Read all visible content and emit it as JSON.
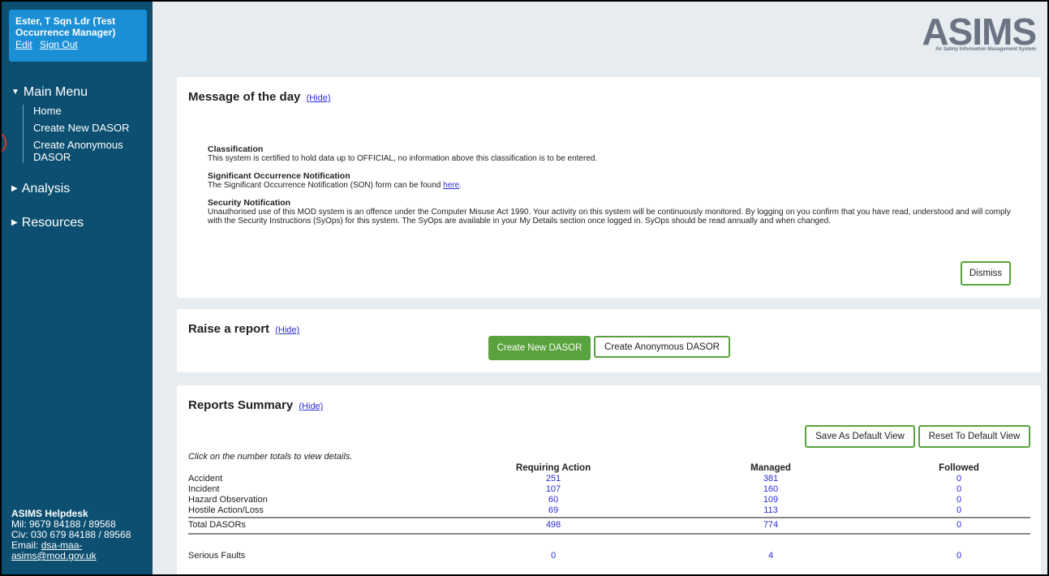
{
  "user": {
    "name_line1": "Ester, T Sqn Ldr (Test",
    "name_line2": "Occurrence Manager)",
    "edit_label": "Edit",
    "signout_label": "Sign Out"
  },
  "menu": {
    "main_label": "Main Menu",
    "items": [
      "Home",
      "Create New DASOR",
      "Create Anonymous DASOR"
    ],
    "analysis_label": "Analysis",
    "resources_label": "Resources"
  },
  "helpdesk": {
    "title": "ASIMS Helpdesk",
    "mil": "Mil: 9679 84188 / 89568",
    "civ": "Civ: 030 679 84188 / 89568",
    "email_label": "Email:",
    "email_line1": "dsa-maa-",
    "email_line2": "asims@mod.gov.uk"
  },
  "logo": {
    "text": "ASIMS",
    "subtitle": "Air Safety Information Management System"
  },
  "motd": {
    "title": "Message of the day",
    "hide_label": "(Hide)",
    "classification_head": "Classification",
    "classification_text": "This system is certified to hold data up to OFFICIAL, no information above this classification is to be entered.",
    "son_head": "Significant Occurrence Notification",
    "son_text": "The Significant Occurrence Notification (SON) form can be found",
    "son_link": "here",
    "security_head": "Security Notification",
    "security_text": "Unauthorised use of this MOD system is an offence under the Computer Misuse Act 1990. Your activity on this system will be continuously monitored. By logging on you confirm that you have read, understood and will comply with the Security Instructions (SyOps) for this system. The SyOps are available in your My Details section once logged in.  SyOps should be read annually and when changed.",
    "dismiss_label": "Dismiss"
  },
  "raise": {
    "title": "Raise a report",
    "hide_label": "(Hide)",
    "new_label": "Create New DASOR",
    "anon_label": "Create Anonymous DASOR"
  },
  "reports": {
    "title": "Reports Summary",
    "hide_label": "(Hide)",
    "save_label": "Save As Default View",
    "reset_label": "Reset To Default View",
    "hint": "Click on the number totals to view details.",
    "headers": [
      "Requiring Action",
      "Managed",
      "Followed"
    ],
    "rows": [
      {
        "label": "Accident",
        "req": "251",
        "man": "381",
        "fol": "0"
      },
      {
        "label": "Incident",
        "req": "107",
        "man": "160",
        "fol": "0"
      },
      {
        "label": "Hazard Observation",
        "req": "60",
        "man": "109",
        "fol": "0"
      },
      {
        "label": "Hostile Action/Loss",
        "req": "69",
        "man": "113",
        "fol": "0"
      }
    ],
    "total": {
      "label": "Total DASORs",
      "req": "498",
      "man": "774",
      "fol": "0"
    },
    "faults": {
      "label": "Serious Faults",
      "req": "0",
      "man": "4",
      "fol": "0"
    }
  }
}
